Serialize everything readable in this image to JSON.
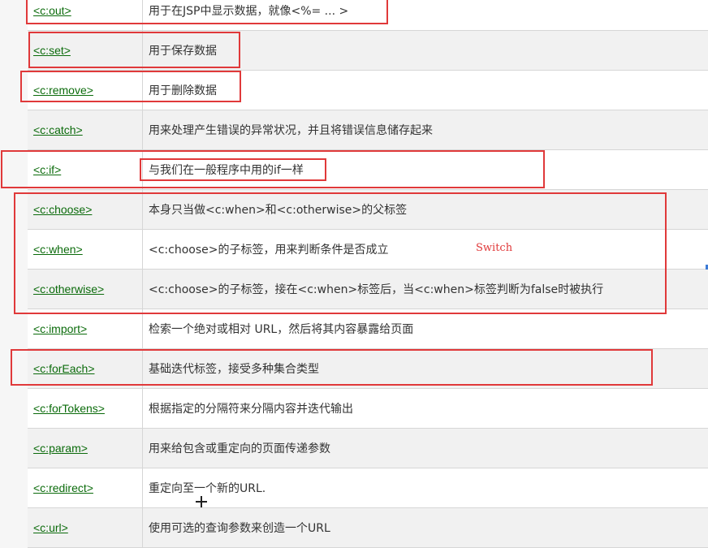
{
  "rows": [
    {
      "tag": "<c:out>",
      "desc": "用于在JSP中显示数据，就像<%= ... >"
    },
    {
      "tag": "<c:set>",
      "desc": "用于保存数据"
    },
    {
      "tag": "<c:remove>",
      "desc": "用于删除数据"
    },
    {
      "tag": "<c:catch>",
      "desc": "用来处理产生错误的异常状况，并且将错误信息储存起来"
    },
    {
      "tag": "<c:if>",
      "desc": "与我们在一般程序中用的if一样"
    },
    {
      "tag": "<c:choose>",
      "desc": "本身只当做<c:when>和<c:otherwise>的父标签"
    },
    {
      "tag": "<c:when>",
      "desc": "<c:choose>的子标签，用来判断条件是否成立"
    },
    {
      "tag": "<c:otherwise>",
      "desc": "<c:choose>的子标签，接在<c:when>标签后，当<c:when>标签判断为false时被执行"
    },
    {
      "tag": "<c:import>",
      "desc": "检索一个绝对或相对 URL，然后将其内容暴露给页面"
    },
    {
      "tag": "<c:forEach>",
      "desc": "基础迭代标签，接受多种集合类型"
    },
    {
      "tag": "<c:forTokens>",
      "desc": "根据指定的分隔符来分隔内容并迭代输出"
    },
    {
      "tag": "<c:param>",
      "desc": "用来给包含或重定向的页面传递参数"
    },
    {
      "tag": "<c:redirect>",
      "desc": "重定向至一个新的URL."
    },
    {
      "tag": "<c:url>",
      "desc": "使用可选的查询参数来创造一个URL"
    }
  ],
  "annotation": {
    "switch_note": "Switch",
    "highlight_color": "#e0393a"
  },
  "colors": {
    "link": "#0b6b0b",
    "text": "#333333",
    "row_alt": "#f1f1f1"
  }
}
